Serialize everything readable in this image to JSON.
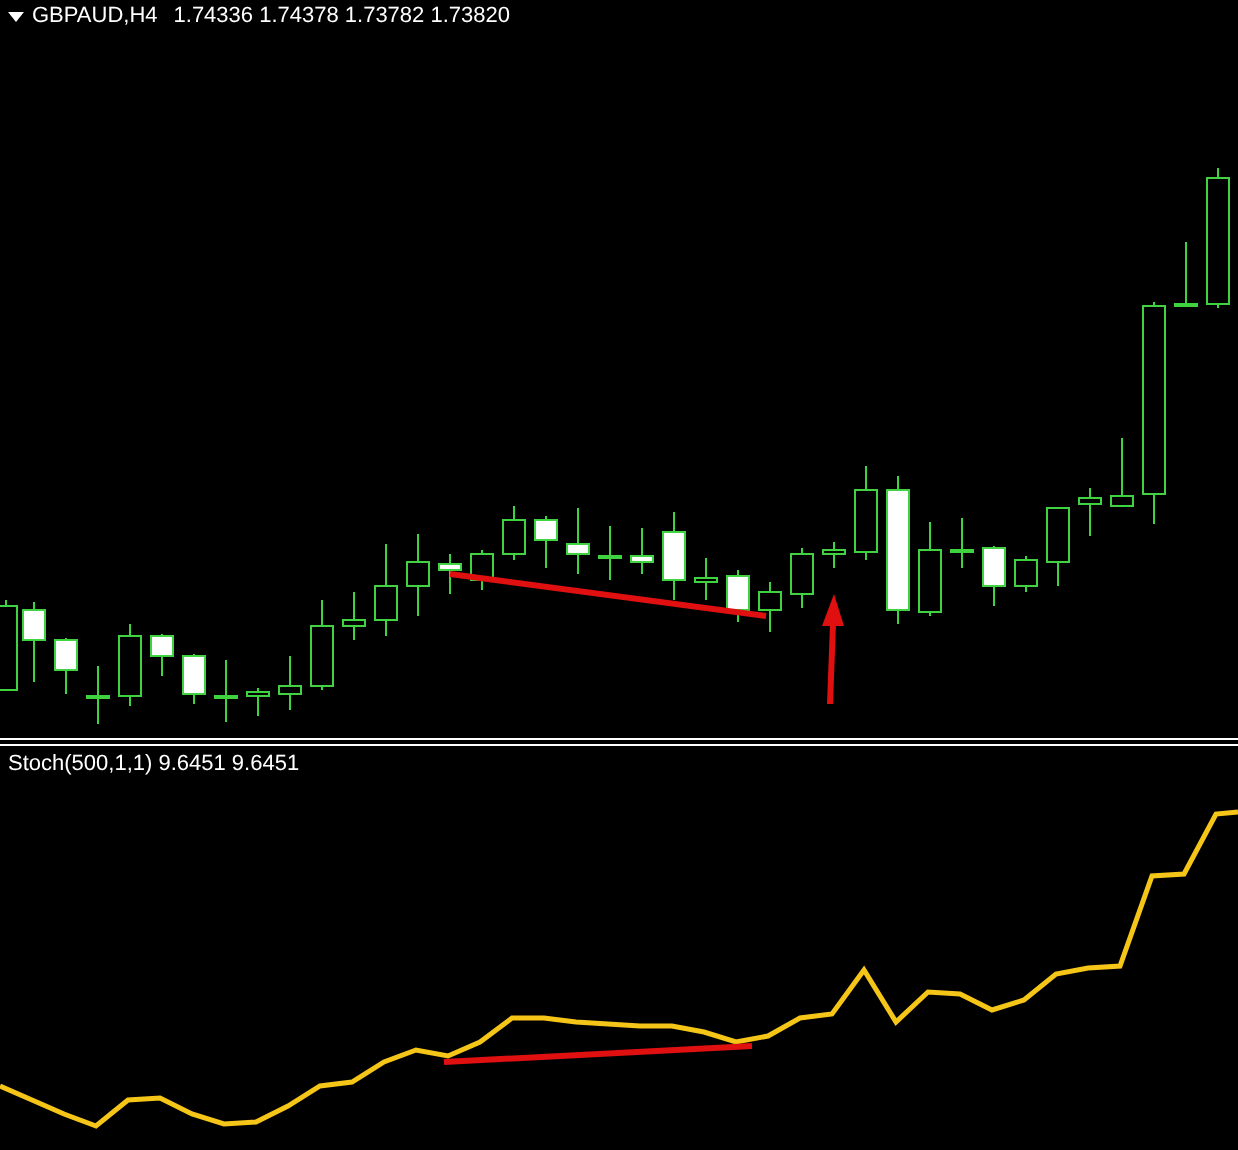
{
  "price_chart": {
    "symbol": "GBPAUD,H4",
    "ohlc": "1.74336 1.74378 1.73782 1.73820"
  },
  "indicator": {
    "label": "Stoch(500,1,1) 9.6451 9.6451"
  }
}
